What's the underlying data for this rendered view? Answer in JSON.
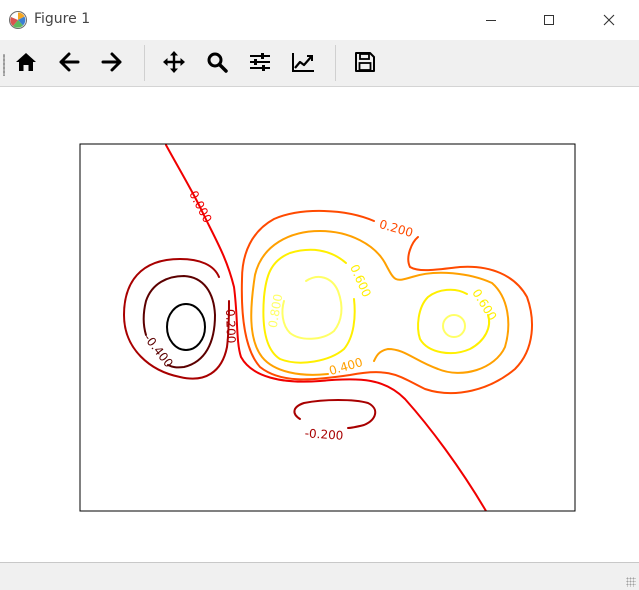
{
  "window": {
    "title": "Figure 1",
    "minimize_icon": "minimize-icon",
    "maximize_icon": "maximize-icon",
    "close_icon": "close-icon"
  },
  "toolbar": {
    "buttons": [
      {
        "name": "home",
        "icon": "home-icon"
      },
      {
        "name": "back",
        "icon": "arrow-left-icon"
      },
      {
        "name": "forward",
        "icon": "arrow-right-icon"
      },
      {
        "name": "pan",
        "icon": "move-icon"
      },
      {
        "name": "zoom",
        "icon": "magnifier-icon"
      },
      {
        "name": "subplots",
        "icon": "sliders-icon"
      },
      {
        "name": "customize",
        "icon": "line-chart-icon"
      },
      {
        "name": "save",
        "icon": "floppy-disk-icon"
      }
    ]
  },
  "chart_data": {
    "type": "contour",
    "title": "",
    "xlabel": "",
    "ylabel": "",
    "axis_ticks": "none",
    "levels": [
      -0.6,
      -0.4,
      -0.2,
      0.0,
      0.2,
      0.4,
      0.6,
      0.8
    ],
    "colormap": "hot",
    "level_colors": {
      "-0.600": "#000000",
      "-0.400": "#5c0000",
      "-0.200": "#a80000",
      "0.000": "#f00000",
      "0.200": "#ff4a00",
      "0.400": "#ffa000",
      "0.600": "#ffef00",
      "0.800": "#ffff66"
    },
    "inline_labels": [
      {
        "text": "0.000",
        "level": 0.0
      },
      {
        "text": "-0.200",
        "level": -0.2
      },
      {
        "text": "-0.400",
        "level": -0.4
      },
      {
        "text": "0.200",
        "level": 0.2
      },
      {
        "text": "0.400",
        "level": 0.4
      },
      {
        "text": "0.600",
        "level": 0.6
      },
      {
        "text": "0.800",
        "level": 0.8
      },
      {
        "text": "0.600",
        "level": 0.6
      },
      {
        "text": "-0.200",
        "level": -0.2
      }
    ]
  }
}
